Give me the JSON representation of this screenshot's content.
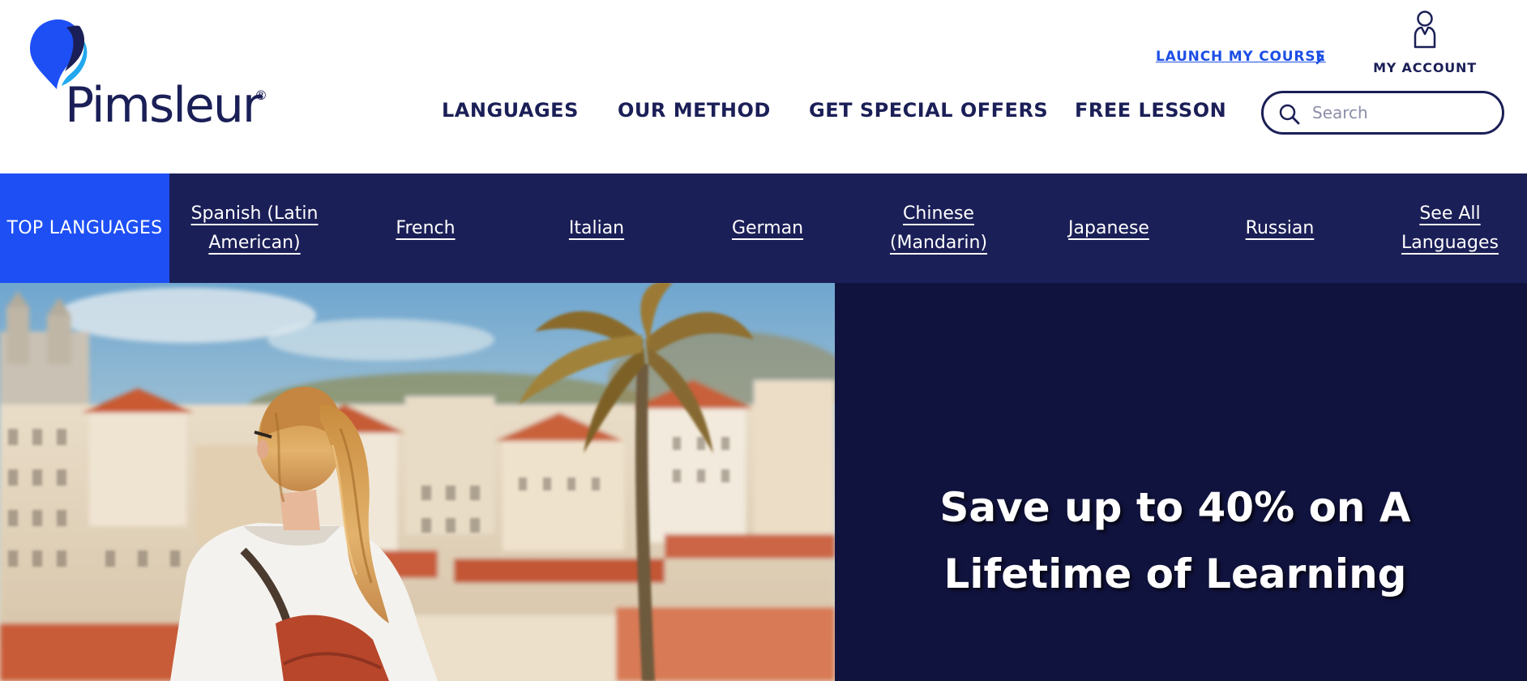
{
  "brand": {
    "name": "Pimsleur",
    "registered": "®",
    "colors": {
      "navy": "#1b1f57",
      "blue": "#1d4ff5",
      "light_blue": "#21a8ef",
      "dark_navy": "#11133f"
    }
  },
  "header": {
    "launch_course": "LAUNCH MY COURSE",
    "account_label": "MY ACCOUNT",
    "nav": [
      "LANGUAGES",
      "OUR METHOD",
      "GET SPECIAL OFFERS",
      "FREE LESSON"
    ],
    "search_placeholder": "Search",
    "icons": {
      "account": "user-icon",
      "search": "search-icon",
      "launch": "chevron-right-icon"
    }
  },
  "language_bar": {
    "heading": "TOP LANGUAGES",
    "items": [
      "Spanish (Latin American)",
      "French",
      "Italian",
      "German",
      "Chinese (Mandarin)",
      "Japanese",
      "Russian",
      "See All Languages"
    ]
  },
  "hero": {
    "headline": "Save up to 40% on A Lifetime of Learning"
  }
}
